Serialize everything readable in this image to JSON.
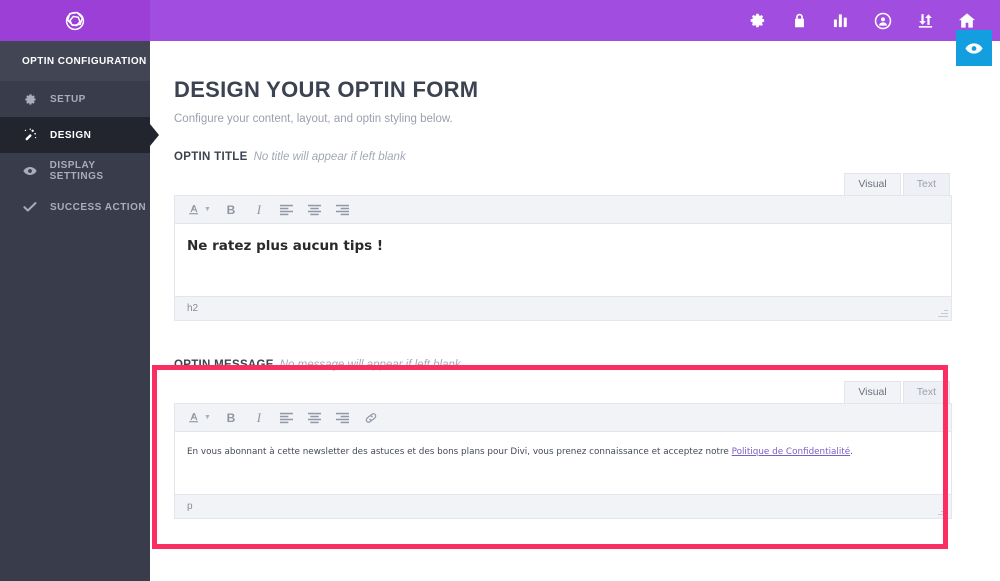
{
  "colors": {
    "brand_purple": "#a14ee0",
    "sidebar_dark": "#393d4b",
    "sidebar_active": "#22252e",
    "preview_blue": "#139fdf",
    "highlight_pink": "#fb2e62",
    "link_purple": "#7b5fc4"
  },
  "topbar": {
    "logo_name": "bloom-logo",
    "icons": [
      {
        "name": "gear-icon",
        "label": "Settings"
      },
      {
        "name": "lock-icon",
        "label": "Account"
      },
      {
        "name": "bar-chart-icon",
        "label": "Stats"
      },
      {
        "name": "user-circle-icon",
        "label": "Profile"
      },
      {
        "name": "import-export-icon",
        "label": "Import / Export"
      },
      {
        "name": "home-icon",
        "label": "Home"
      }
    ],
    "preview_button": {
      "name": "eye-icon",
      "label": "Preview"
    }
  },
  "sidebar": {
    "title": "OPTIN CONFIGURATION",
    "items": [
      {
        "label": "SETUP",
        "icon": "gear-icon",
        "active": false
      },
      {
        "label": "DESIGN",
        "icon": "magic-wand-icon",
        "active": true
      },
      {
        "label": "DISPLAY SETTINGS",
        "icon": "eye-icon",
        "active": false
      },
      {
        "label": "SUCCESS ACTION",
        "icon": "check-icon",
        "active": false
      }
    ]
  },
  "main": {
    "page_title": "DESIGN YOUR OPTIN FORM",
    "page_subtitle": "Configure your content, layout, and optin styling below.",
    "optin_title_section": {
      "label": "OPTIN TITLE",
      "hint": "No title will appear if left blank",
      "tabs": [
        {
          "label": "Visual",
          "active": true
        },
        {
          "label": "Text",
          "active": false
        }
      ],
      "toolbar": [
        {
          "name": "text-color-icon",
          "glyph": "A"
        },
        {
          "name": "bold-icon",
          "glyph": "B"
        },
        {
          "name": "italic-icon",
          "glyph": "I"
        },
        {
          "name": "align-left-icon",
          "glyph": ""
        },
        {
          "name": "align-center-icon",
          "glyph": ""
        },
        {
          "name": "align-right-icon",
          "glyph": ""
        }
      ],
      "content": "Ne ratez plus aucun tips !",
      "status": "h2"
    },
    "optin_message_section": {
      "label": "OPTIN MESSAGE",
      "hint": "No message will appear if left blank",
      "tabs": [
        {
          "label": "Visual",
          "active": true
        },
        {
          "label": "Text",
          "active": false
        }
      ],
      "toolbar": [
        {
          "name": "text-color-icon",
          "glyph": "A"
        },
        {
          "name": "bold-icon",
          "glyph": "B"
        },
        {
          "name": "italic-icon",
          "glyph": "I"
        },
        {
          "name": "align-left-icon",
          "glyph": ""
        },
        {
          "name": "align-center-icon",
          "glyph": ""
        },
        {
          "name": "align-right-icon",
          "glyph": ""
        },
        {
          "name": "link-icon",
          "glyph": ""
        }
      ],
      "content_before_link": "En vous abonnant à cette newsletter des astuces et des bons plans pour Divi, vous prenez connaissance et acceptez notre ",
      "content_link": "Politique de Confidentialité",
      "content_after_link": ".",
      "status": "p"
    }
  }
}
